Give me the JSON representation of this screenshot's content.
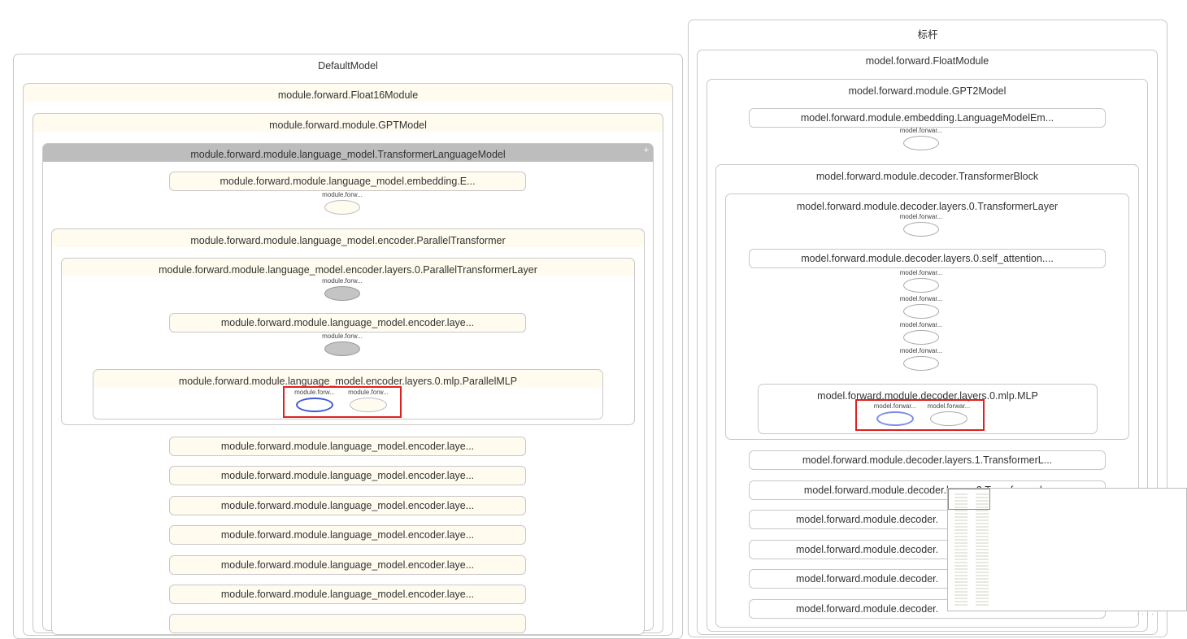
{
  "left_graph": {
    "root_title": "DefaultModel",
    "float16_module": "module.forward.Float16Module",
    "gpt_model": "module.forward.module.GPTModel",
    "transformer_lm": "module.forward.module.language_model.TransformerLanguageModel",
    "embedding": "module.forward.module.language_model.embedding.E...",
    "embedding_node": "module.forw...",
    "parallel_transformer": "module.forward.module.language_model.encoder.ParallelTransformer",
    "layer0": "module.forward.module.language_model.encoder.layers.0.ParallelTransformerLayer",
    "layer0_node": "module.forw...",
    "layer0_sub": "module.forward.module.language_model.encoder.laye...",
    "layer0_sub_node": "module.forw...",
    "mlp": "module.forward.module.language_model.encoder.layers.0.mlp.ParallelMLP",
    "mlp_node_1": "module.forw...",
    "mlp_node_2": "module.forw...",
    "layers": [
      "module.forward.module.language_model.encoder.laye...",
      "module.forward.module.language_model.encoder.laye...",
      "module.forward.module.language_model.encoder.laye...",
      "module.forward.module.language_model.encoder.laye...",
      "module.forward.module.language_model.encoder.laye...",
      "module.forward.module.language_model.encoder.laye..."
    ]
  },
  "right_graph": {
    "root_title": "标杆",
    "float_module": "model.forward.FloatModule",
    "gpt2_model": "model.forward.module.GPT2Model",
    "embedding": "model.forward.module.embedding.LanguageModelEm...",
    "embedding_node": "model.forwar...",
    "transformer_block": "model.forward.module.decoder.TransformerBlock",
    "layer0": "model.forward.module.decoder.layers.0.TransformerLayer",
    "layer0_node": "model.forwar...",
    "self_attention": "model.forward.module.decoder.layers.0.self_attention....",
    "attn_nodes": [
      "model.forwar...",
      "model.forwar...",
      "model.forwar...",
      "model.forwar..."
    ],
    "mlp": "model.forward.module.decoder.layers.0.mlp.MLP",
    "mlp_node_1": "model.forwar...",
    "mlp_node_2": "model.forwar...",
    "layer1": "model.forward.module.decoder.layers.1.TransformerL...",
    "layers": [
      "model.forward.module.decoder.layers.2.Transformerl...",
      "model.forward.module.decoder.",
      "model.forward.module.decoder.",
      "model.forward.module.decoder.",
      "model.forward.module.decoder."
    ]
  },
  "colors": {
    "highlight": "#e02020",
    "match_blue": "#3f5bd6",
    "cream": "#fffbef",
    "expanded_gray": "#bdbdbd"
  }
}
